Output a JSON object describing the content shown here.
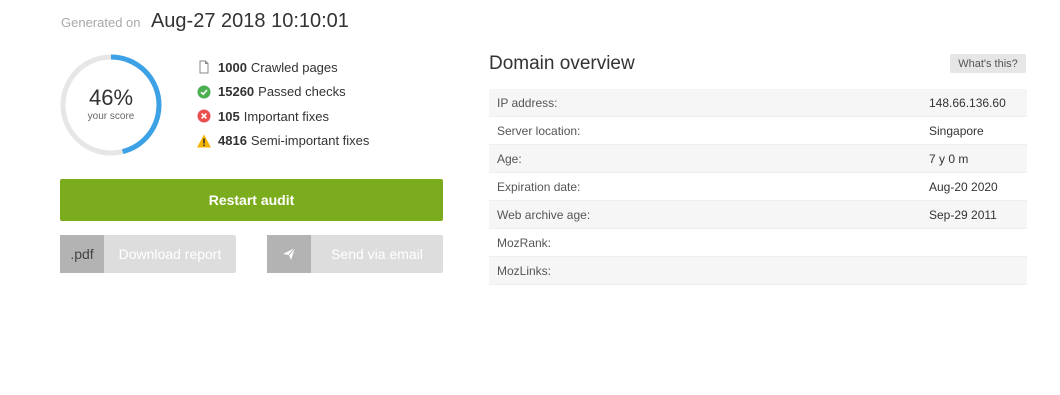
{
  "header": {
    "generated_label": "Generated on",
    "generated_date": "Aug-27 2018 10:10:01"
  },
  "score": {
    "percent_text": "46%",
    "value": 0.46,
    "subtitle": "your score",
    "ring_color": "#3da1e6",
    "track_color": "#e6e6e6"
  },
  "stats": [
    {
      "icon": "page-icon",
      "count": "1000",
      "label": "Crawled pages"
    },
    {
      "icon": "check-circle-icon",
      "count": "15260",
      "label": "Passed checks",
      "color": "#4caf50"
    },
    {
      "icon": "x-circle-icon",
      "count": "105",
      "label": "Important fixes",
      "color": "#e94f4f"
    },
    {
      "icon": "warning-icon",
      "count": "4816",
      "label": "Semi-important fixes",
      "color": "#f5b400"
    }
  ],
  "actions": {
    "restart_label": "Restart audit",
    "pdf_tag": ".pdf",
    "download_label": "Download report",
    "email_label": "Send via email",
    "restart_color": "#7bac1d"
  },
  "domain": {
    "title": "Domain overview",
    "help_label": "What's this?",
    "rows": [
      {
        "key": "IP address:",
        "value": "148.66.136.60"
      },
      {
        "key": "Server location:",
        "value": "Singapore"
      },
      {
        "key": "Age:",
        "value": "7 y 0 m"
      },
      {
        "key": "Expiration date:",
        "value": "Aug-20 2020"
      },
      {
        "key": "Web archive age:",
        "value": "Sep-29 2011"
      },
      {
        "key": "MozRank:",
        "value": ""
      },
      {
        "key": "MozLinks:",
        "value": ""
      }
    ]
  }
}
